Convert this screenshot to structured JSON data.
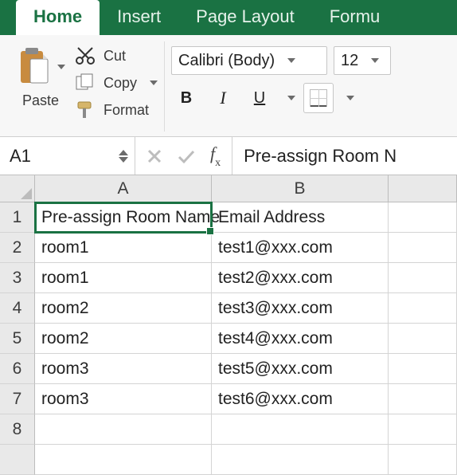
{
  "tabs": {
    "home": "Home",
    "insert": "Insert",
    "page_layout": "Page Layout",
    "formulas": "Formu"
  },
  "clipboard": {
    "paste": "Paste",
    "cut": "Cut",
    "copy": "Copy",
    "format": "Format"
  },
  "font": {
    "name": "Calibri (Body)",
    "size": "12"
  },
  "name_box": "A1",
  "formula_bar": "Pre-assign Room N",
  "columns": {
    "a": "A",
    "b": "B"
  },
  "row_numbers": [
    "1",
    "2",
    "3",
    "4",
    "5",
    "6",
    "7",
    "8",
    ""
  ],
  "grid": [
    {
      "a": "Pre-assign Room Name",
      "b": "Email Address"
    },
    {
      "a": "room1",
      "b": "test1@xxx.com"
    },
    {
      "a": "room1",
      "b": "test2@xxx.com"
    },
    {
      "a": "room2",
      "b": "test3@xxx.com"
    },
    {
      "a": "room2",
      "b": "test4@xxx.com"
    },
    {
      "a": "room3",
      "b": "test5@xxx.com"
    },
    {
      "a": "room3",
      "b": "test6@xxx.com"
    },
    {
      "a": "",
      "b": ""
    },
    {
      "a": "",
      "b": ""
    }
  ],
  "chart_data": {
    "type": "table",
    "headers": [
      "Pre-assign Room Name",
      "Email Address"
    ],
    "rows": [
      [
        "room1",
        "test1@xxx.com"
      ],
      [
        "room1",
        "test2@xxx.com"
      ],
      [
        "room2",
        "test3@xxx.com"
      ],
      [
        "room2",
        "test4@xxx.com"
      ],
      [
        "room3",
        "test5@xxx.com"
      ],
      [
        "room3",
        "test6@xxx.com"
      ]
    ]
  }
}
